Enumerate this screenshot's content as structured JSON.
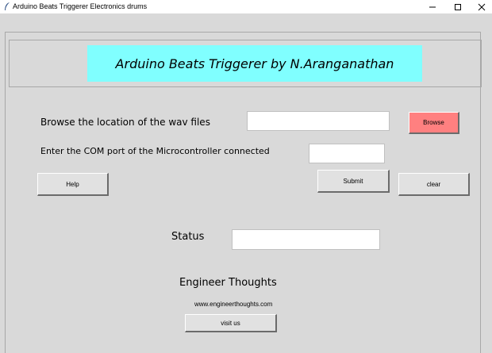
{
  "window": {
    "title": "Arduino Beats Triggerer Electronics drums",
    "icon": "feather-icon",
    "controls": [
      "minimize-icon",
      "maximize-icon",
      "close-icon"
    ]
  },
  "banner": {
    "text": "Arduino Beats Triggerer by N.Aranganathan",
    "background": "#80ffff"
  },
  "browse_row": {
    "label": "Browse the location of the wav files",
    "value": "",
    "button_label": "Browse",
    "button_color": "#ff8080"
  },
  "com_row": {
    "label": "Enter the COM port of the Microcontroller connected",
    "value": ""
  },
  "buttons": {
    "help": "Help",
    "submit": "Submit",
    "clear": "clear"
  },
  "status": {
    "label": "Status",
    "value": ""
  },
  "footer": {
    "heading": "Engineer Thoughts",
    "url": "www.engineerthoughts.com",
    "visit_label": "visit us"
  }
}
